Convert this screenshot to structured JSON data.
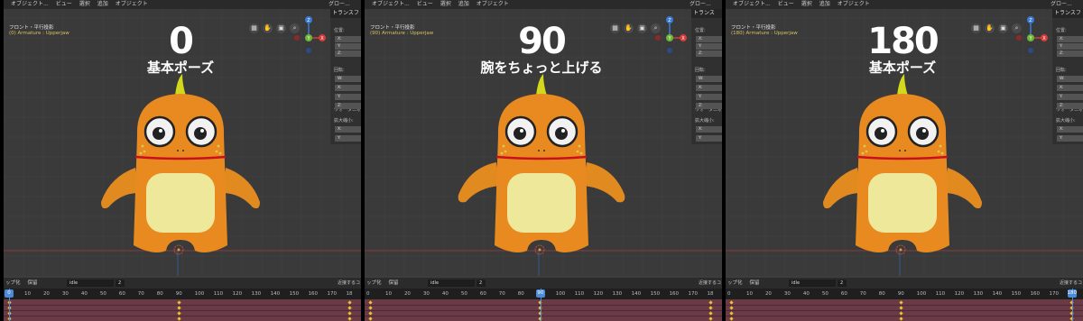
{
  "panels": [
    {
      "header": {
        "items": [
          "オブジェクト...",
          "ビュー",
          "選択",
          "追加",
          "オブジェクト"
        ],
        "right": "グロー..."
      },
      "viewport": {
        "view_name": "フロント・平行投影",
        "object_info": "(0) Armature : Upperjaw"
      },
      "frame_big": "0",
      "caption": "基本ポーズ",
      "npanel": {
        "title": "トランスフ",
        "sections": [
          "位置:",
          "回転:",
          "ウォータニオ",
          "拡大縮小:"
        ],
        "fields": [
          "X:",
          "Y:",
          "Z:",
          "W:",
          "X:",
          "Y:",
          "Z:",
          "X:",
          "Y:",
          "Z:"
        ]
      },
      "timeline": {
        "left_label": "ップ化",
        "keying": "保留",
        "action": "idle",
        "action_users": "2",
        "right_label": "近接するコ",
        "current_frame": 0,
        "ticks": [
          "10",
          "20",
          "30",
          "40",
          "50",
          "60",
          "70",
          "80",
          "90",
          "100",
          "110",
          "120",
          "130",
          "140",
          "150",
          "160",
          "170",
          "18"
        ],
        "keyframes": [
          0,
          90,
          180
        ]
      }
    },
    {
      "header": {
        "items": [
          "オブジェクト...",
          "ビュー",
          "選択",
          "追加",
          "オブジェクト"
        ],
        "right": "グロー..."
      },
      "viewport": {
        "view_name": "フロント・平行投影",
        "object_info": "(90) Armature : Upperjaw"
      },
      "frame_big": "90",
      "caption": "腕をちょっと上げる",
      "npanel": {
        "title": "トランス",
        "sections": [
          "位置:",
          "回転:",
          "ウォータニオ",
          "拡大縮小:"
        ],
        "fields": [
          "X:",
          "Y:",
          "Z:",
          "W:",
          "X:",
          "Y:",
          "Z:",
          "X:",
          "Y:",
          "Z:"
        ]
      },
      "timeline": {
        "left_label": "ップ化",
        "keying": "保留",
        "action": "idle",
        "action_users": "2",
        "right_label": "近接するコ",
        "current_frame": 90,
        "ticks": [
          "0",
          "10",
          "20",
          "30",
          "40",
          "50",
          "60",
          "70",
          "80",
          "100",
          "110",
          "120",
          "130",
          "140",
          "150",
          "160",
          "170",
          "18"
        ],
        "keyframes": [
          0,
          90,
          180
        ]
      }
    },
    {
      "header": {
        "items": [
          "オブジェクト...",
          "ビュー",
          "選択",
          "追加",
          "オブジェクト"
        ],
        "right": "グロー..."
      },
      "viewport": {
        "view_name": "フロント・平行投影",
        "object_info": "(180) Armature : Upperjaw"
      },
      "frame_big": "180",
      "caption": "基本ポーズ",
      "npanel": {
        "title": "トランスフ",
        "sections": [
          "位置:",
          "回転:",
          "ウォータニオ",
          "拡大縮小:"
        ],
        "fields": [
          "X:",
          "Y:",
          "Z:",
          "W:",
          "X:",
          "Y:",
          "Z:",
          "X:",
          "Y:",
          "Z:"
        ]
      },
      "timeline": {
        "left_label": "ップ化",
        "keying": "保留",
        "action": "idle",
        "action_users": "2",
        "right_label": "近接するコ",
        "current_frame": 180,
        "ticks": [
          "0",
          "10",
          "20",
          "30",
          "40",
          "50",
          "60",
          "70",
          "80",
          "90",
          "100",
          "110",
          "120",
          "130",
          "140",
          "150",
          "160",
          "170"
        ],
        "keyframes": [
          0,
          90,
          180
        ]
      }
    }
  ],
  "gizmo": {
    "z_label": "Z",
    "y_label": "Y",
    "x_label": "X"
  },
  "colors": {
    "character": "#e88a1f",
    "belly": "#eee89a",
    "mouth": "#c8101e",
    "keyframe": "#f0c030",
    "playhead": "#4d8ad8",
    "timeline_bg": "#6a3b47"
  }
}
